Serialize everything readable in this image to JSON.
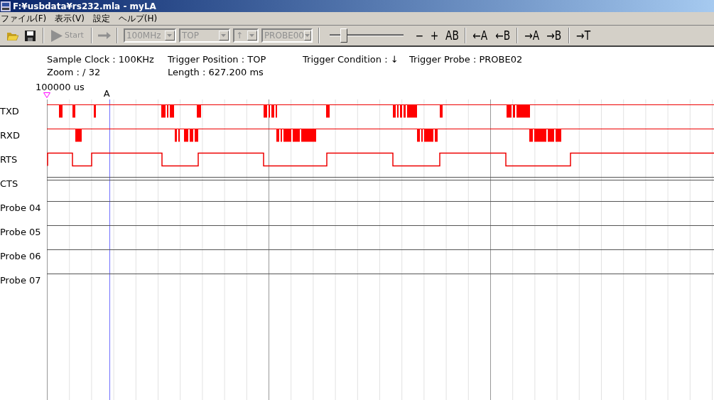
{
  "window": {
    "title": "F:¥usbdata¥rs232.mla - myLA"
  },
  "menu": [
    {
      "label": "ファイル(F)"
    },
    {
      "label": "表示(V)"
    },
    {
      "label": "設定"
    },
    {
      "label": "ヘルプ(H)"
    }
  ],
  "toolbar": {
    "start": {
      "label": "Start",
      "disabled": true
    },
    "selects": [
      {
        "value": "100MHz",
        "disabled": true,
        "kind": "wide"
      },
      {
        "value": "TOP",
        "disabled": true,
        "kind": "wide"
      },
      {
        "value": "↑",
        "disabled": true,
        "kind": "narrow"
      },
      {
        "value": "PROBE00",
        "disabled": true,
        "kind": "wide"
      }
    ],
    "zoom_slider": {
      "level": 0.16
    },
    "buttons": [
      "−",
      "+",
      "AB",
      "←A",
      "←B",
      "→A",
      "→B",
      "→T"
    ]
  },
  "info": [
    [
      "Sample Clock : 100KHz",
      "Zoom : /  32"
    ],
    [
      "Trigger Position : TOP",
      "Length : 627.200 ms"
    ],
    [
      "Trigger Condition : ↓"
    ],
    [
      "Trigger Probe : PROBE02"
    ]
  ],
  "timeline": {
    "start": "100000 us",
    "cursor": "A"
  },
  "channels": [
    {
      "name": "TXD",
      "kind": "pulses"
    },
    {
      "name": "RXD",
      "kind": "pulses"
    },
    {
      "name": "RTS",
      "kind": "level"
    },
    {
      "name": "CTS",
      "kind": "flat"
    },
    {
      "name": "Probe 04",
      "kind": "flat"
    },
    {
      "name": "Probe 05",
      "kind": "flat"
    },
    {
      "name": "Probe 06",
      "kind": "flat"
    },
    {
      "name": "Probe 07",
      "kind": "flat"
    }
  ]
}
